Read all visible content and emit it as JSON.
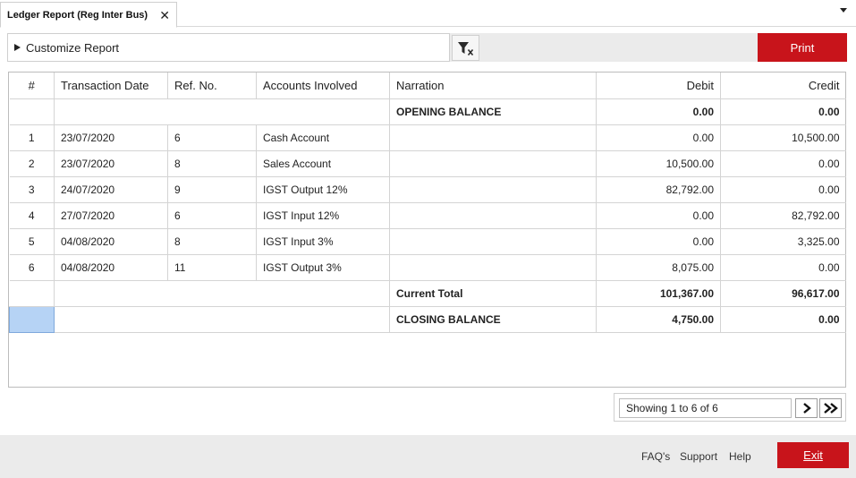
{
  "tab": {
    "title": "Ledger Report (Reg Inter Bus)",
    "close_glyph": "✕"
  },
  "toolbar": {
    "customize_label": "Customize Report",
    "print_label": "Print"
  },
  "table": {
    "headers": [
      "#",
      "Transaction Date",
      "Ref. No.",
      "Accounts Involved",
      "Narration",
      "Debit",
      "Credit"
    ],
    "opening": {
      "label": "OPENING BALANCE",
      "debit": "0.00",
      "credit": "0.00"
    },
    "rows": [
      {
        "idx": "1",
        "date": "23/07/2020",
        "ref": "6",
        "account": "Cash Account",
        "narration": "",
        "debit": "0.00",
        "credit": "10,500.00"
      },
      {
        "idx": "2",
        "date": "23/07/2020",
        "ref": "8",
        "account": "Sales Account",
        "narration": "",
        "debit": "10,500.00",
        "credit": "0.00"
      },
      {
        "idx": "3",
        "date": "24/07/2020",
        "ref": "9",
        "account": "IGST Output 12%",
        "narration": "",
        "debit": "82,792.00",
        "credit": "0.00"
      },
      {
        "idx": "4",
        "date": "27/07/2020",
        "ref": "6",
        "account": "IGST Input 12%",
        "narration": "",
        "debit": "0.00",
        "credit": "82,792.00"
      },
      {
        "idx": "5",
        "date": "04/08/2020",
        "ref": "8",
        "account": "IGST Input 3%",
        "narration": "",
        "debit": "0.00",
        "credit": "3,325.00"
      },
      {
        "idx": "6",
        "date": "04/08/2020",
        "ref": "11",
        "account": "IGST Output 3%",
        "narration": "",
        "debit": "8,075.00",
        "credit": "0.00"
      }
    ],
    "current_total": {
      "label": "Current Total",
      "debit": "101,367.00",
      "credit": "96,617.00"
    },
    "closing": {
      "label": "CLOSING BALANCE",
      "debit": "4,750.00",
      "credit": "0.00"
    }
  },
  "pager": {
    "info": "Showing 1 to 6 of 6"
  },
  "footer": {
    "faq": "FAQ's",
    "support": "Support",
    "help": "Help",
    "exit": "Exit"
  },
  "colors": {
    "accent_red": "#c8141b",
    "selection_blue": "#b6d3f5",
    "panel_gray": "#ebebeb"
  },
  "icons": [
    "close-icon",
    "dropdown-caret-icon",
    "expand-arrow-icon",
    "clear-filter-icon",
    "next-page-icon",
    "last-page-icon"
  ]
}
